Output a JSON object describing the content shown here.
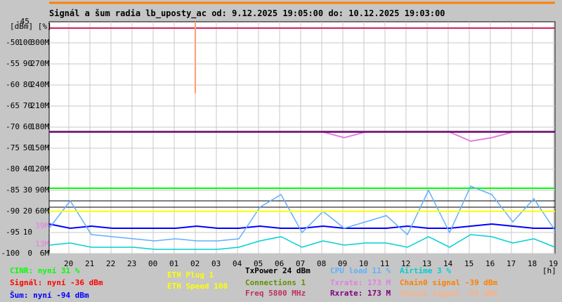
{
  "chart_data": {
    "type": "line",
    "title": "Signál a šum radia lb_uposty_ac od: 9.12.2025 19:05:00 do: 10.12.2025 19:03:00",
    "y_units_label": "[dBm] [%]",
    "y_top_label": "-45",
    "ylim": [
      -100,
      -45
    ],
    "y_ticks": [
      {
        "dbm": "-50",
        "pct": "100",
        "rate": "300M",
        "v": -50
      },
      {
        "dbm": "-55",
        "pct": "90",
        "rate": "270M",
        "v": -55
      },
      {
        "dbm": "-60",
        "pct": "80",
        "rate": "240M",
        "v": -60
      },
      {
        "dbm": "-65",
        "pct": "70",
        "rate": "210M",
        "v": -65
      },
      {
        "dbm": "-70",
        "pct": "60",
        "rate": "180M",
        "v": -70
      },
      {
        "dbm": "-75",
        "pct": "50",
        "rate": "150M",
        "v": -75
      },
      {
        "dbm": "-80",
        "pct": "40",
        "rate": "120M",
        "v": -80
      },
      {
        "dbm": "-85",
        "pct": "30",
        "rate": "90M",
        "v": -85
      },
      {
        "dbm": "-90",
        "pct": "20",
        "rate": "60M",
        "v": -90
      },
      {
        "dbm": "-95",
        "pct": "10",
        "rate": "",
        "v": -95
      },
      {
        "dbm": "-100",
        "pct": "0",
        "rate": "6M",
        "v": -100
      }
    ],
    "extra_rate_labels": [
      {
        "text": "39M",
        "v": -93.5,
        "color": "#e080e0"
      },
      {
        "text": "13M",
        "v": -97.8,
        "color": "#e080e0"
      }
    ],
    "x_ticks": [
      "20",
      "21",
      "22",
      "23",
      "00",
      "01",
      "02",
      "03",
      "04",
      "05",
      "06",
      "07",
      "08",
      "09",
      "10",
      "11",
      "12",
      "13",
      "14",
      "15",
      "16",
      "17",
      "18",
      "19"
    ],
    "x_unit": "[h]",
    "x_start_hour": 19.083,
    "series": [
      {
        "name": "Šum",
        "color": "#0000ff",
        "unit": "dBm",
        "values": [
          -93,
          -94,
          -93.5,
          -94,
          -94,
          -94,
          -94,
          -93.5,
          -94,
          -94,
          -93.5,
          -94,
          -94,
          -93.5,
          -94,
          -94,
          -94,
          -93.5,
          -94,
          -94,
          -93.5,
          -93,
          -93.5,
          -94,
          -94
        ]
      },
      {
        "name": "CINR",
        "color": "#00ff00",
        "unit": "%",
        "values": [
          31,
          31,
          31,
          31,
          31,
          31,
          31,
          31,
          31,
          31,
          31,
          31,
          31,
          31,
          31,
          31,
          31,
          31,
          31,
          31,
          31,
          31,
          31,
          31,
          31
        ]
      },
      {
        "name": "CPU load",
        "color": "#60b0ff",
        "unit": "%",
        "values": [
          12,
          25,
          9,
          8,
          7,
          6,
          7,
          6,
          6,
          7,
          22,
          28,
          10,
          20,
          12,
          15,
          18,
          9,
          30,
          10,
          32,
          28,
          15,
          26,
          11
        ]
      },
      {
        "name": "Airtime",
        "color": "#00d0d0",
        "unit": "%",
        "values": [
          4,
          5,
          3,
          3,
          3,
          2,
          2,
          2,
          2,
          3,
          6,
          8,
          3,
          6,
          4,
          5,
          5,
          3,
          8,
          3,
          9,
          8,
          5,
          7,
          3
        ]
      },
      {
        "name": "Txrate",
        "color": "#e080e0",
        "unit": "M",
        "values": [
          173,
          173,
          173,
          173,
          173,
          173,
          173,
          173,
          173,
          173,
          173,
          173,
          173,
          173,
          165,
          173,
          173,
          173,
          173,
          173,
          160,
          165,
          173,
          173,
          173
        ]
      },
      {
        "name": "Rxrate",
        "color": "#800080",
        "unit": "M",
        "values": [
          173,
          173,
          173,
          173,
          173,
          173,
          173,
          173,
          173,
          173,
          173,
          173,
          173,
          173,
          173,
          173,
          173,
          173,
          173,
          173,
          173,
          173,
          173,
          173,
          173
        ]
      },
      {
        "name": "ETH Plug",
        "color": "#ffff00",
        "unit": "dBm",
        "values": [
          -90,
          -90,
          -90,
          -90,
          -90,
          -90,
          -90,
          -90,
          -90,
          -90,
          -90,
          -90,
          -90,
          -90,
          -90,
          -90,
          -90,
          -90,
          -90,
          -90,
          -90,
          -90,
          -90,
          -90,
          -90
        ]
      },
      {
        "name": "Freq",
        "color": "#d02060",
        "unit": "dBm",
        "values": [
          -46.5,
          -46.5,
          -46.5,
          -46.5,
          -46.5,
          -46.5,
          -46.5,
          -46.5,
          -46.5,
          -46.5,
          -46.5,
          -46.5,
          -46.5,
          -46.5,
          -46.5,
          -46.5,
          -46.5,
          -46.5,
          -46.5,
          -46.5,
          -46.5,
          -46.5,
          -46.5,
          -46.5,
          -46.5
        ]
      }
    ],
    "spike": {
      "name": "Chain1 signal",
      "hour_offset": 7,
      "from": -45,
      "to": -62,
      "color": "#ffa070"
    },
    "black_lines": [
      -71,
      -87.5,
      -89
    ]
  },
  "legend": [
    {
      "text": "CINR: nyní 31 %",
      "color": "#00ff00"
    },
    {
      "text": "Signál: nyní -36 dBm",
      "color": "#ff0000"
    },
    {
      "text": "Šum: nyní -94 dBm",
      "color": "#0000ff"
    },
    {
      "text": "ETH Plug 1",
      "color": "#ffff00"
    },
    {
      "text": "ETH Speed 100",
      "color": "#ffff00"
    },
    {
      "text": "TxPower 24 dBm",
      "color": "#000000"
    },
    {
      "text": "Connections 1",
      "color": "#609000"
    },
    {
      "text": "Freq 5800 MHz",
      "color": "#c03060"
    },
    {
      "text": "CPU load 11 %",
      "color": "#60b0ff"
    },
    {
      "text": "Txrate: 173 M",
      "color": "#e080e0"
    },
    {
      "text": "Rxrate: 173 M",
      "color": "#800080"
    },
    {
      "text": "Airtime 3 %",
      "color": "#00d0d0"
    },
    {
      "text": "Chain0 signal -39 dBm",
      "color": "#ff8000"
    },
    {
      "text": "Chain1 signal -39 dBm",
      "color": "#ffb080"
    }
  ]
}
